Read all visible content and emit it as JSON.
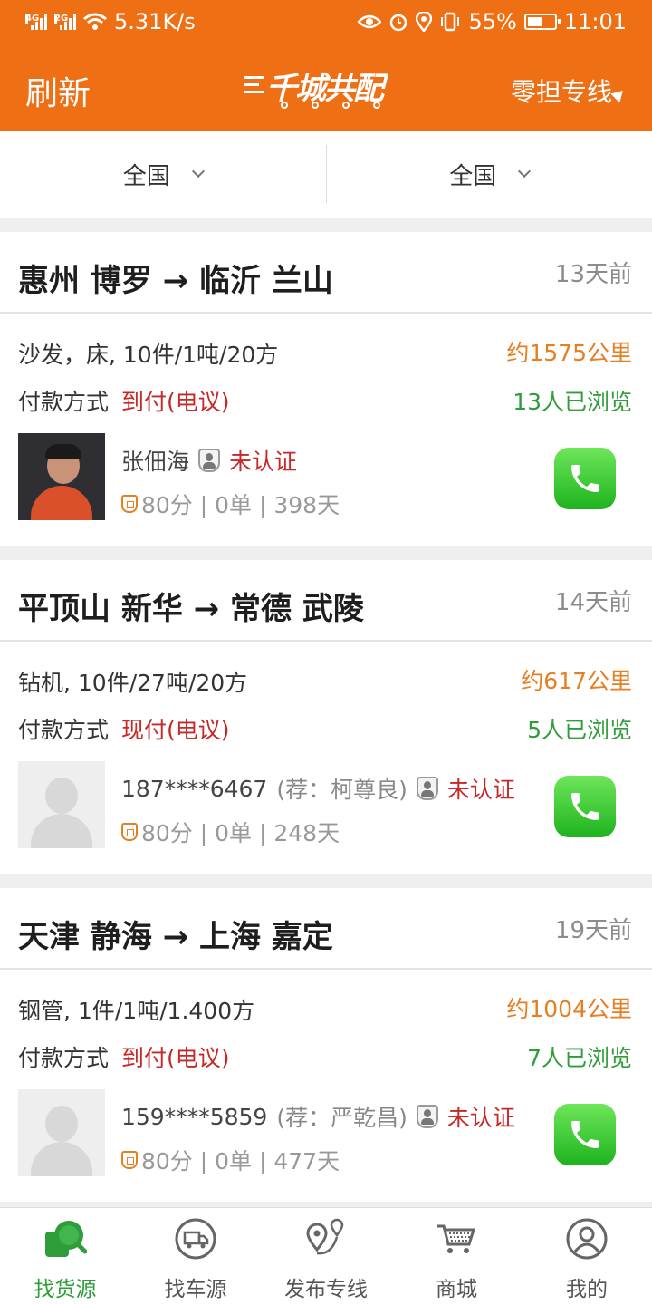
{
  "status_bar": {
    "net_left": "4G",
    "net_right": "2G",
    "speed": "5.31K/s",
    "battery": "55%",
    "battery_level": 0.55,
    "time": "11:01"
  },
  "header": {
    "refresh_label": "刷新",
    "logo_text": "千城共配",
    "route_select_label": "零担专线"
  },
  "filters": {
    "from": "全国",
    "to": "全国"
  },
  "listings": [
    {
      "route": "惠州 博罗 → 临沂 兰山",
      "time_ago": "13天前",
      "cargo": "沙发，床, 10件/1吨/20方",
      "distance": "约1575公里",
      "pay_label": "付款方式",
      "pay_value": "到付(电议)",
      "views": "13人已浏览",
      "user": "张佃海",
      "user_ref": "",
      "verify": "未认证",
      "stats": "80分 | 0单 | 398天",
      "avatar": "photo"
    },
    {
      "route": "平顶山 新华 → 常德 武陵",
      "time_ago": "14天前",
      "cargo": "钻机, 10件/27吨/20方",
      "distance": "约617公里",
      "pay_label": "付款方式",
      "pay_value": "现付(电议)",
      "views": "5人已浏览",
      "user": "187****6467",
      "user_ref": "(荐：柯尊良)",
      "verify": "未认证",
      "stats": "80分 | 0单 | 248天",
      "avatar": "placeholder"
    },
    {
      "route": "天津 静海 → 上海 嘉定",
      "time_ago": "19天前",
      "cargo": "钢管, 1件/1吨/1.400方",
      "distance": "约1004公里",
      "pay_label": "付款方式",
      "pay_value": "到付(电议)",
      "views": "7人已浏览",
      "user": "159****5859",
      "user_ref": "(荐：严乾昌)",
      "verify": "未认证",
      "stats": "80分 | 0单 | 477天",
      "avatar": "placeholder"
    }
  ],
  "bottom_nav": [
    {
      "label": "找货源",
      "icon": "search-cargo-icon",
      "active": true
    },
    {
      "label": "找车源",
      "icon": "truck-icon",
      "active": false
    },
    {
      "label": "发布专线",
      "icon": "route-pin-icon",
      "active": false
    },
    {
      "label": "商城",
      "icon": "cart-icon",
      "active": false
    },
    {
      "label": "我的",
      "icon": "user-icon",
      "active": false
    }
  ],
  "colors": {
    "brand": "#ef6f15",
    "distance": "#e67e22",
    "views": "#2e9d3a",
    "warning": "#c62828",
    "active_nav": "#2e9d3a"
  }
}
